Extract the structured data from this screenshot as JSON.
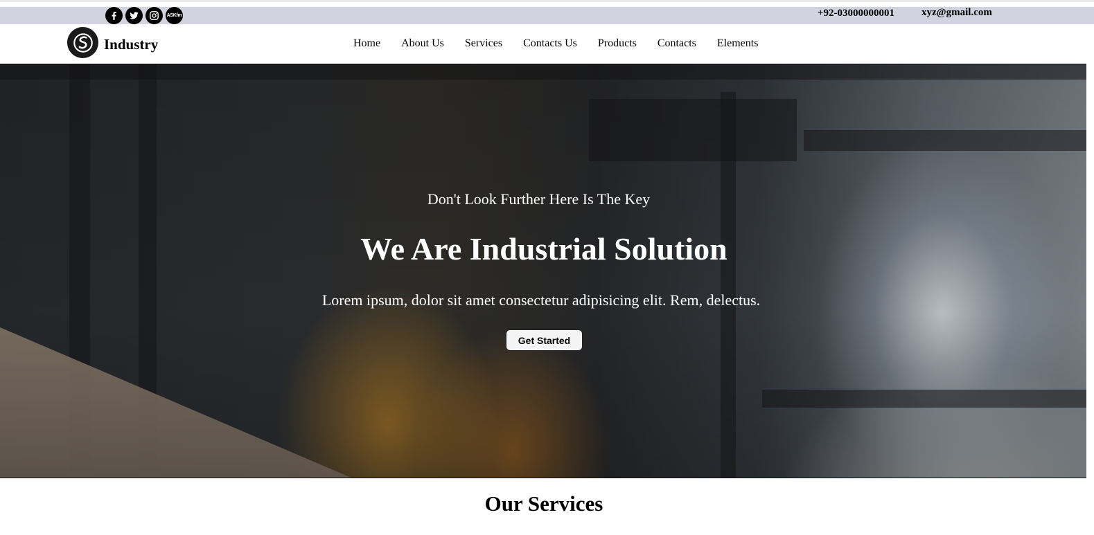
{
  "topbar": {
    "social": [
      {
        "icon": "facebook-icon"
      },
      {
        "icon": "twitter-icon"
      },
      {
        "icon": "instagram-icon"
      },
      {
        "icon": "askfm-icon",
        "text": "ASKfm"
      }
    ],
    "phone": "+92-03000000001",
    "email": "xyz@gmail.com"
  },
  "navbar": {
    "logo_icon": "company-logo-icon",
    "brand": "Industry",
    "menu": [
      "Home",
      "About Us",
      "Services",
      "Contacts Us",
      "Products",
      "Contacts",
      "Elements"
    ]
  },
  "hero": {
    "kicker": "Don't Look Further Here Is The Key",
    "title": "We Are Industrial Solution",
    "subtitle": "Lorem ipsum, dolor sit amet consectetur adipisicing elit. Rem, delectus.",
    "button": "Get Started"
  },
  "services": {
    "title": "Our Services"
  },
  "colors": {
    "topbar_bg": "#d3d3e0",
    "button_bg": "#f4f4f4"
  }
}
